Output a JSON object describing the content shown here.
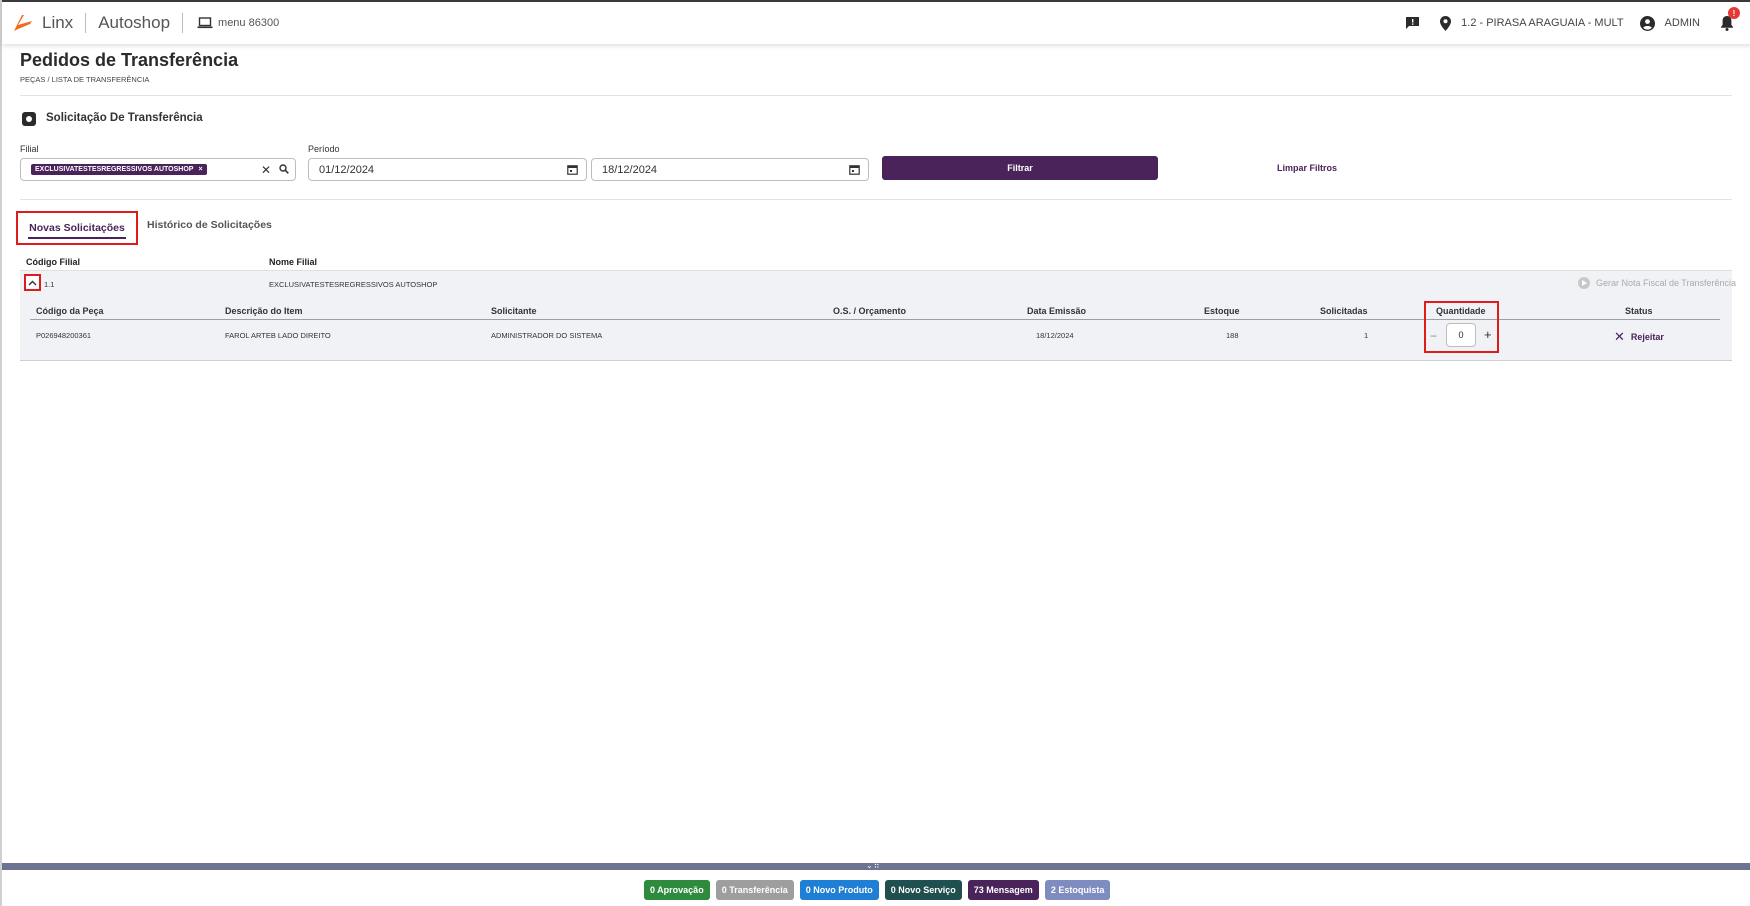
{
  "app": {
    "brand": "Linx",
    "product": "Autoshop",
    "menu_code": "menu 86300",
    "branch": "1.2 - PIRASA ARAGUAIA - MULT",
    "user": "ADMIN",
    "notifications_count": "!"
  },
  "page": {
    "title": "Pedidos de Transferência",
    "breadcrumb": "PEÇAS / LISTA DE TRANSFERÊNCIA",
    "section_title": "Solicitação De Transferência"
  },
  "filters": {
    "filial_label": "Filial",
    "filial_chip": "EXCLUSIVATESTESREGRESSIVOS AUTOSHOP",
    "periodo_label": "Período",
    "date_from": "01/12/2024",
    "date_to": "18/12/2024",
    "filter_button": "Filtrar",
    "clear_button": "Limpar Filtros"
  },
  "tabs": [
    {
      "label": "Novas Solicitações",
      "active": true
    },
    {
      "label": "Histórico de Solicitações",
      "active": false
    }
  ],
  "group_table": {
    "headers": [
      "Código Filial",
      "Nome Filial"
    ],
    "row": {
      "codigo": "1.1",
      "nome": "EXCLUSIVATESTESREGRESSIVOS AUTOSHOP"
    },
    "action": "Gerar Nota Fiscal de Transferência"
  },
  "items_table": {
    "headers": [
      "Código da Peça",
      "Descrição do Item",
      "Solicitante",
      "O.S. / Orçamento",
      "Data Emissão",
      "Estoque",
      "Solicitadas",
      "Quantidade",
      "Status"
    ],
    "row": {
      "codigo": "P026948200361",
      "descricao": "FAROL ARTEB LADO DIREITO",
      "solicitante": "ADMINISTRADOR DO SISTEMA",
      "os": "",
      "data": "18/12/2024",
      "estoque": "188",
      "solicitadas": "1",
      "quantidade": "0",
      "status_action": "Rejeitar"
    }
  },
  "bottom_pills": [
    {
      "label": "0 Aprovação",
      "color": "#2e8b3e"
    },
    {
      "label": "0 Transferência",
      "color": "#9e9e9e"
    },
    {
      "label": "0 Novo Produto",
      "color": "#1e7fd4"
    },
    {
      "label": "0 Novo Serviço",
      "color": "#1f4f4f"
    },
    {
      "label": "73 Mensagem",
      "color": "#4a235a"
    },
    {
      "label": "2 Estoquista",
      "color": "#7f8cc0"
    }
  ],
  "colors": {
    "primary": "#4a235a",
    "highlight": "#e01b1b",
    "logo": "#f26b1d"
  }
}
